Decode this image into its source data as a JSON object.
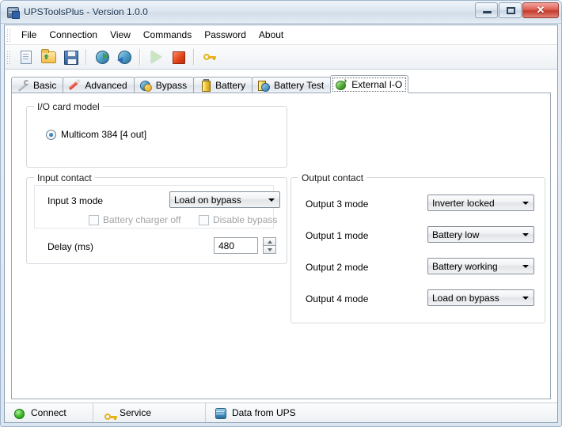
{
  "window": {
    "title": "UPSToolsPlus - Version 1.0.0",
    "app_icon": "ups-app-icon",
    "controls": {
      "minimize": "minimize-button",
      "maximize": "maximize-button",
      "close_glyph": "✕"
    }
  },
  "menubar": {
    "items": [
      {
        "label": "File"
      },
      {
        "label": "Connection"
      },
      {
        "label": "View"
      },
      {
        "label": "Commands"
      },
      {
        "label": "Password"
      },
      {
        "label": "About"
      }
    ]
  },
  "toolbar": {
    "buttons": [
      {
        "icon": "new-document-icon",
        "group": 1
      },
      {
        "icon": "open-folder-icon",
        "group": 1
      },
      {
        "icon": "save-icon",
        "group": 1
      },
      {
        "icon": "connect-network-icon",
        "group": 2
      },
      {
        "icon": "disconnect-network-icon",
        "group": 2
      },
      {
        "icon": "play-icon",
        "group": 3
      },
      {
        "icon": "stop-icon",
        "group": 3
      },
      {
        "icon": "key-icon",
        "group": 4
      }
    ]
  },
  "tabs": [
    {
      "label": "Basic",
      "icon": "wrench-icon",
      "active": false
    },
    {
      "label": "Advanced",
      "icon": "pen-icon",
      "active": false
    },
    {
      "label": "Bypass",
      "icon": "bypass-icon",
      "active": false
    },
    {
      "label": "Battery",
      "icon": "battery-icon",
      "active": false
    },
    {
      "label": "Battery Test",
      "icon": "battery-test-icon",
      "active": false
    },
    {
      "label": "External I-O",
      "icon": "external-io-icon",
      "active": true
    }
  ],
  "io_card_model": {
    "group_title": "I/O card model",
    "option_label": "Multicom 384 [4 out]",
    "selected": true
  },
  "input_contact": {
    "group_title": "Input contact",
    "input3_mode_label": "Input 3 mode",
    "input3_mode_value": "Load on bypass",
    "checkbox_battery_charger_off": {
      "label": "Battery charger off",
      "checked": false,
      "enabled": false
    },
    "checkbox_disable_bypass": {
      "label": "Disable bypass",
      "checked": false,
      "enabled": false
    },
    "delay_label": "Delay (ms)",
    "delay_value": "480"
  },
  "output_contact": {
    "group_title": "Output contact",
    "rows": [
      {
        "label": "Output 3 mode",
        "value": "Inverter locked"
      },
      {
        "label": "Output 1 mode",
        "value": "Battery low"
      },
      {
        "label": "Output 2 mode",
        "value": "Battery working"
      },
      {
        "label": "Output 4 mode",
        "value": "Load on bypass"
      }
    ]
  },
  "statusbar": {
    "panels": [
      {
        "label": "Connect",
        "icon": "green-status-dot-icon"
      },
      {
        "label": "Service",
        "icon": "key-icon"
      },
      {
        "label": "Data from UPS",
        "icon": "database-icon"
      }
    ]
  },
  "colors": {
    "accent_blue": "#16538f",
    "status_green": "#49c131",
    "close_red": "#c53a2c",
    "group_border": "#d5d9de"
  }
}
